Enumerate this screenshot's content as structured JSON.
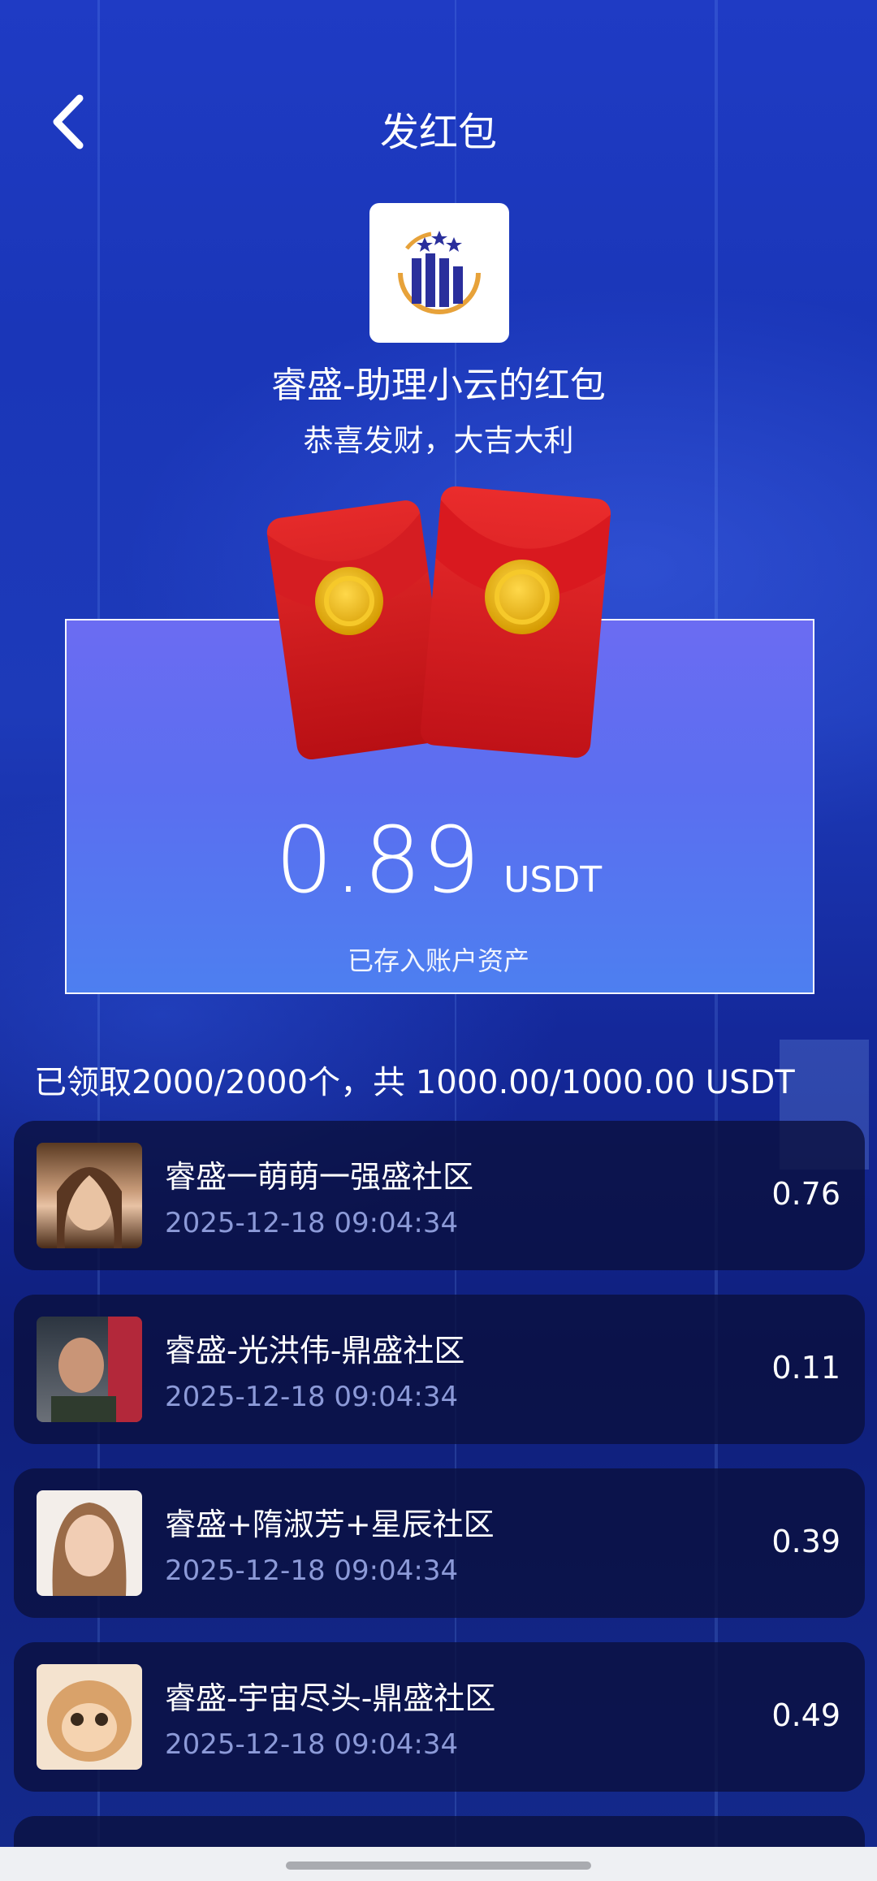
{
  "header": {
    "title": "发红包"
  },
  "packet": {
    "sender": "睿盛-助理小云的红包",
    "greeting": "恭喜发财，大吉大利",
    "amount": "0.89",
    "unit": "USDT",
    "stored_label": "已存入账户资产"
  },
  "summary": "已领取2000/2000个，共 1000.00/1000.00 USDT",
  "records": [
    {
      "name": "睿盛一萌萌一强盛社区",
      "time": "2025-12-18 09:04:34",
      "amount": "0.76"
    },
    {
      "name": "睿盛-光洪伟-鼎盛社区",
      "time": "2025-12-18 09:04:34",
      "amount": "0.11"
    },
    {
      "name": "睿盛+隋淑芳+星辰社区",
      "time": "2025-12-18 09:04:34",
      "amount": "0.39"
    },
    {
      "name": "睿盛-宇宙尽头-鼎盛社区",
      "time": "2025-12-18 09:04:34",
      "amount": "0.49"
    }
  ],
  "icons": {
    "back": "chevron-left-icon",
    "logo": "company-logo",
    "envelope": "red-envelope-icon"
  },
  "colors": {
    "accent_blue": "#1d3ab9",
    "envelope_red": "#d8191f",
    "coin_gold": "#e8b400"
  }
}
